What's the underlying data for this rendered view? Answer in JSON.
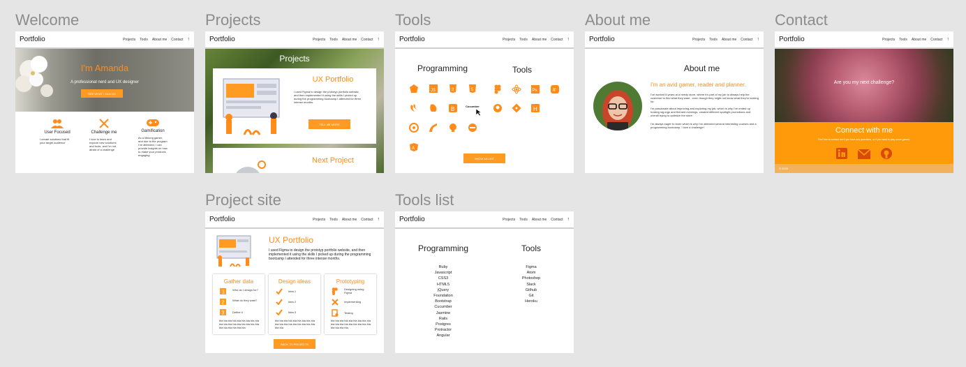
{
  "nav": {
    "brand": "Portfolio",
    "links": [
      "Projects",
      "Tools",
      "About me",
      "Contact",
      "↑"
    ]
  },
  "frames": {
    "welcome": {
      "title": "Welcome",
      "hero_title": "I'm Amanda",
      "hero_subtitle": "A professional nerd and UX designer",
      "hero_button": "SEE WHAT I CAN DO",
      "features": [
        {
          "icon": "users-icon",
          "title": "User Focused",
          "text": "I create solutions that fit your target audience"
        },
        {
          "icon": "swords-icon",
          "title": "Challenge me",
          "text": "I love to learn and explore new solutions and tools, and I'm not afraid of a challenge"
        },
        {
          "icon": "gamepad-icon",
          "title": "Gamification",
          "text": "As a lifelong gamer, and due to the program I've attended, I can provide insights on how to make your products engaging"
        }
      ]
    },
    "projects": {
      "title": "Projects",
      "heading": "Projects",
      "card_title": "UX Portfolio",
      "card_text": "I used Figma to design the prototyp portfolio website, and then implemented it using the skills I picked up during the programming bootcamp I attended for three intense months.",
      "card_button": "TELL ME MORE",
      "next_title": "Next Project"
    },
    "tools": {
      "title": "Tools",
      "programming": "Programming",
      "tools_heading": "Tools",
      "tooltip": "Cucumber",
      "button": "SHOW AS LIST"
    },
    "about": {
      "title": "About me",
      "heading": "About me",
      "tagline": "I'm an avid gamer, reader and planner.",
      "p1": "I've worked 8 years at a needy store, where it's part of my job to always help the customer to find what they want - even though they might not know what they're looking for.",
      "p2": "I'm passionate about improving and exploring my job, which is why I've ended up hosting sig-inge and themed evenings, created different spotlight promotions and overall trying to optimize the store.",
      "p3": "I'm always eager to learn which is why I've attended several interesting courses and a programming bootcamp. I love a challenge!"
    },
    "contact": {
      "title": "Contact",
      "hero_text": "Are you my next challenge?",
      "connect_title": "Connect with me",
      "connect_text": "Feel free to contact me if you have any questions, or if you want to play some games.",
      "footer": "© 2020"
    },
    "project_site": {
      "title": "Project site",
      "heading": "UX Portfolio",
      "text": "I used Figma to design the prototyp portfolio website, and then implemented it using the skills I picked up during the programming bootcamp I attended for three intense months.",
      "columns": [
        {
          "title": "Gather data",
          "items": [
            {
              "icon": "number-1-icon",
              "label": "Who do I design for?"
            },
            {
              "icon": "number-2-icon",
              "label": "What do they want?"
            },
            {
              "icon": "number-3-icon",
              "label": "Define it"
            }
          ],
          "filler": "bla bla bla bla bla bla bla bla bla bla bla bla bla bla bla bla bla bla bla bla bla bla bla bla"
        },
        {
          "title": "Design ideas",
          "items": [
            {
              "icon": "check-icon",
              "label": "Idea 1"
            },
            {
              "icon": "check-icon",
              "label": "Idea 2"
            },
            {
              "icon": "check-icon",
              "label": "Idea 3"
            }
          ],
          "filler": "bla bla bla bla bla bla bla bla bla bla bla bla bla bla bla bla bla bla bla bla"
        },
        {
          "title": "Prototyping",
          "items": [
            {
              "icon": "figma-icon",
              "label": "Designing using Figma"
            },
            {
              "icon": "tools-icon",
              "label": "Implementing"
            },
            {
              "icon": "test-icon",
              "label": "Testing"
            }
          ],
          "filler": "bla bla bla bla bla bla bla bla bla bla bla bla bla bla bla bla bla bla bla bla bla bla"
        }
      ],
      "button": "BACK TO PROJECTS"
    },
    "tools_list": {
      "title": "Tools list",
      "programming": "Programming",
      "tools_heading": "Tools",
      "programming_items": [
        "Ruby",
        "Javascript",
        "CSS3",
        "HTML5",
        "jQuery",
        "Foundation",
        "Bootstrap",
        "Cucumber",
        "Jasmine",
        "Rails",
        "Postgres",
        "Protractor",
        "Angular"
      ],
      "tools_items": [
        "Figma",
        "Atom",
        "Photoshop",
        "Slack",
        "Github",
        "Git",
        "Heroku"
      ]
    }
  },
  "colors": {
    "accent": "#ff8c1a",
    "button": "#ff9a22",
    "page_bg": "#e5e5e5"
  }
}
